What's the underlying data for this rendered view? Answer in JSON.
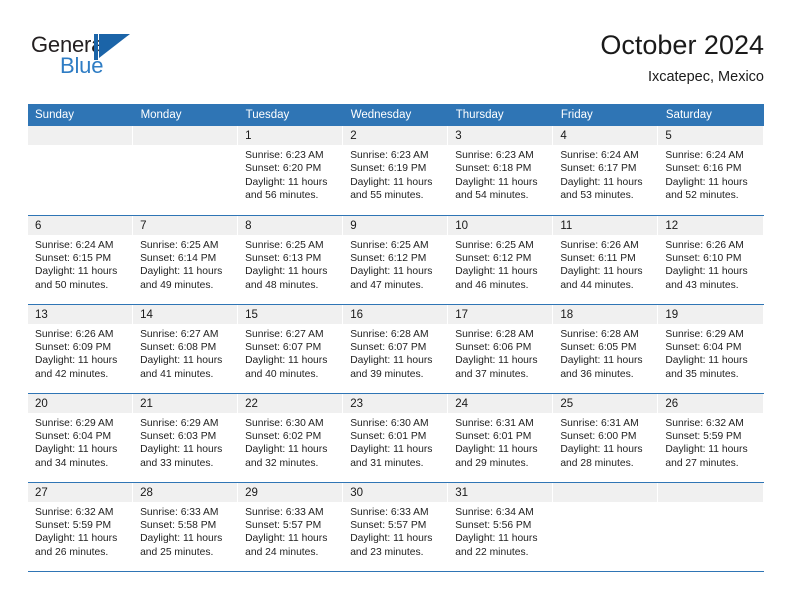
{
  "brand": {
    "name_part1": "General",
    "name_part2": "Blue",
    "mark": "triangle-logo"
  },
  "header": {
    "title": "October 2024",
    "subtitle": "Ixcatepec, Mexico"
  },
  "calendar": {
    "weekday_headers": [
      "Sunday",
      "Monday",
      "Tuesday",
      "Wednesday",
      "Thursday",
      "Friday",
      "Saturday"
    ],
    "accent_color": "#2f75b5",
    "daynum_band_color": "#f0f0f0",
    "weeks": [
      [
        {
          "day": "",
          "empty": true
        },
        {
          "day": "",
          "empty": true
        },
        {
          "day": "1",
          "sunrise": "Sunrise: 6:23 AM",
          "sunset": "Sunset: 6:20 PM",
          "daylight_line1": "Daylight: 11 hours",
          "daylight_line2": "and 56 minutes."
        },
        {
          "day": "2",
          "sunrise": "Sunrise: 6:23 AM",
          "sunset": "Sunset: 6:19 PM",
          "daylight_line1": "Daylight: 11 hours",
          "daylight_line2": "and 55 minutes."
        },
        {
          "day": "3",
          "sunrise": "Sunrise: 6:23 AM",
          "sunset": "Sunset: 6:18 PM",
          "daylight_line1": "Daylight: 11 hours",
          "daylight_line2": "and 54 minutes."
        },
        {
          "day": "4",
          "sunrise": "Sunrise: 6:24 AM",
          "sunset": "Sunset: 6:17 PM",
          "daylight_line1": "Daylight: 11 hours",
          "daylight_line2": "and 53 minutes."
        },
        {
          "day": "5",
          "sunrise": "Sunrise: 6:24 AM",
          "sunset": "Sunset: 6:16 PM",
          "daylight_line1": "Daylight: 11 hours",
          "daylight_line2": "and 52 minutes."
        }
      ],
      [
        {
          "day": "6",
          "sunrise": "Sunrise: 6:24 AM",
          "sunset": "Sunset: 6:15 PM",
          "daylight_line1": "Daylight: 11 hours",
          "daylight_line2": "and 50 minutes."
        },
        {
          "day": "7",
          "sunrise": "Sunrise: 6:25 AM",
          "sunset": "Sunset: 6:14 PM",
          "daylight_line1": "Daylight: 11 hours",
          "daylight_line2": "and 49 minutes."
        },
        {
          "day": "8",
          "sunrise": "Sunrise: 6:25 AM",
          "sunset": "Sunset: 6:13 PM",
          "daylight_line1": "Daylight: 11 hours",
          "daylight_line2": "and 48 minutes."
        },
        {
          "day": "9",
          "sunrise": "Sunrise: 6:25 AM",
          "sunset": "Sunset: 6:12 PM",
          "daylight_line1": "Daylight: 11 hours",
          "daylight_line2": "and 47 minutes."
        },
        {
          "day": "10",
          "sunrise": "Sunrise: 6:25 AM",
          "sunset": "Sunset: 6:12 PM",
          "daylight_line1": "Daylight: 11 hours",
          "daylight_line2": "and 46 minutes."
        },
        {
          "day": "11",
          "sunrise": "Sunrise: 6:26 AM",
          "sunset": "Sunset: 6:11 PM",
          "daylight_line1": "Daylight: 11 hours",
          "daylight_line2": "and 44 minutes."
        },
        {
          "day": "12",
          "sunrise": "Sunrise: 6:26 AM",
          "sunset": "Sunset: 6:10 PM",
          "daylight_line1": "Daylight: 11 hours",
          "daylight_line2": "and 43 minutes."
        }
      ],
      [
        {
          "day": "13",
          "sunrise": "Sunrise: 6:26 AM",
          "sunset": "Sunset: 6:09 PM",
          "daylight_line1": "Daylight: 11 hours",
          "daylight_line2": "and 42 minutes."
        },
        {
          "day": "14",
          "sunrise": "Sunrise: 6:27 AM",
          "sunset": "Sunset: 6:08 PM",
          "daylight_line1": "Daylight: 11 hours",
          "daylight_line2": "and 41 minutes."
        },
        {
          "day": "15",
          "sunrise": "Sunrise: 6:27 AM",
          "sunset": "Sunset: 6:07 PM",
          "daylight_line1": "Daylight: 11 hours",
          "daylight_line2": "and 40 minutes."
        },
        {
          "day": "16",
          "sunrise": "Sunrise: 6:28 AM",
          "sunset": "Sunset: 6:07 PM",
          "daylight_line1": "Daylight: 11 hours",
          "daylight_line2": "and 39 minutes."
        },
        {
          "day": "17",
          "sunrise": "Sunrise: 6:28 AM",
          "sunset": "Sunset: 6:06 PM",
          "daylight_line1": "Daylight: 11 hours",
          "daylight_line2": "and 37 minutes."
        },
        {
          "day": "18",
          "sunrise": "Sunrise: 6:28 AM",
          "sunset": "Sunset: 6:05 PM",
          "daylight_line1": "Daylight: 11 hours",
          "daylight_line2": "and 36 minutes."
        },
        {
          "day": "19",
          "sunrise": "Sunrise: 6:29 AM",
          "sunset": "Sunset: 6:04 PM",
          "daylight_line1": "Daylight: 11 hours",
          "daylight_line2": "and 35 minutes."
        }
      ],
      [
        {
          "day": "20",
          "sunrise": "Sunrise: 6:29 AM",
          "sunset": "Sunset: 6:04 PM",
          "daylight_line1": "Daylight: 11 hours",
          "daylight_line2": "and 34 minutes."
        },
        {
          "day": "21",
          "sunrise": "Sunrise: 6:29 AM",
          "sunset": "Sunset: 6:03 PM",
          "daylight_line1": "Daylight: 11 hours",
          "daylight_line2": "and 33 minutes."
        },
        {
          "day": "22",
          "sunrise": "Sunrise: 6:30 AM",
          "sunset": "Sunset: 6:02 PM",
          "daylight_line1": "Daylight: 11 hours",
          "daylight_line2": "and 32 minutes."
        },
        {
          "day": "23",
          "sunrise": "Sunrise: 6:30 AM",
          "sunset": "Sunset: 6:01 PM",
          "daylight_line1": "Daylight: 11 hours",
          "daylight_line2": "and 31 minutes."
        },
        {
          "day": "24",
          "sunrise": "Sunrise: 6:31 AM",
          "sunset": "Sunset: 6:01 PM",
          "daylight_line1": "Daylight: 11 hours",
          "daylight_line2": "and 29 minutes."
        },
        {
          "day": "25",
          "sunrise": "Sunrise: 6:31 AM",
          "sunset": "Sunset: 6:00 PM",
          "daylight_line1": "Daylight: 11 hours",
          "daylight_line2": "and 28 minutes."
        },
        {
          "day": "26",
          "sunrise": "Sunrise: 6:32 AM",
          "sunset": "Sunset: 5:59 PM",
          "daylight_line1": "Daylight: 11 hours",
          "daylight_line2": "and 27 minutes."
        }
      ],
      [
        {
          "day": "27",
          "sunrise": "Sunrise: 6:32 AM",
          "sunset": "Sunset: 5:59 PM",
          "daylight_line1": "Daylight: 11 hours",
          "daylight_line2": "and 26 minutes."
        },
        {
          "day": "28",
          "sunrise": "Sunrise: 6:33 AM",
          "sunset": "Sunset: 5:58 PM",
          "daylight_line1": "Daylight: 11 hours",
          "daylight_line2": "and 25 minutes."
        },
        {
          "day": "29",
          "sunrise": "Sunrise: 6:33 AM",
          "sunset": "Sunset: 5:57 PM",
          "daylight_line1": "Daylight: 11 hours",
          "daylight_line2": "and 24 minutes."
        },
        {
          "day": "30",
          "sunrise": "Sunrise: 6:33 AM",
          "sunset": "Sunset: 5:57 PM",
          "daylight_line1": "Daylight: 11 hours",
          "daylight_line2": "and 23 minutes."
        },
        {
          "day": "31",
          "sunrise": "Sunrise: 6:34 AM",
          "sunset": "Sunset: 5:56 PM",
          "daylight_line1": "Daylight: 11 hours",
          "daylight_line2": "and 22 minutes."
        },
        {
          "day": "",
          "empty": true
        },
        {
          "day": "",
          "empty": true
        }
      ]
    ]
  }
}
